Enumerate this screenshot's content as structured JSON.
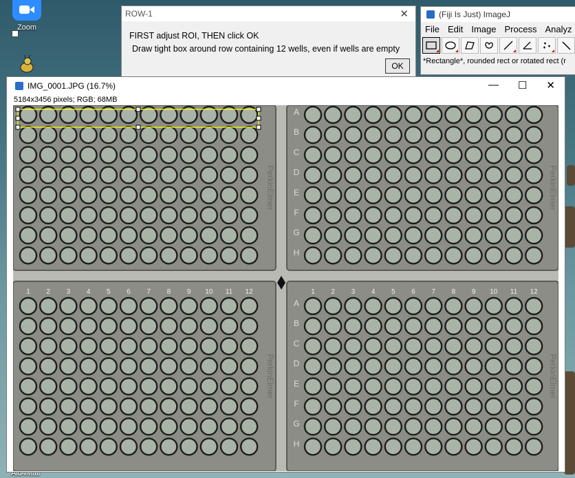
{
  "desktop": {
    "zoom_label": "Zoom",
    "aid4mail_label": "Aid4Mail"
  },
  "imagej": {
    "title": "(Fiji Is Just) ImageJ",
    "menus": [
      "File",
      "Edit",
      "Image",
      "Process",
      "Analyz"
    ],
    "tools": [
      "rectangle-icon",
      "oval-icon",
      "polygon-icon",
      "freehand-icon",
      "line-icon",
      "angle-icon",
      "multipoint-icon",
      "wand-icon"
    ],
    "status": "*Rectangle*, rounded rect or rotated rect (r"
  },
  "dialog": {
    "title": "ROW-1",
    "line1": "FIRST adjust ROI, THEN click OK",
    "line2": "Draw tight box around row containing 12 wells, even if wells are empty",
    "ok_label": "OK"
  },
  "image_window": {
    "title": "IMG_0001.JPG (16.7%)",
    "info": "5184x3456 pixels; RGB; 68MB",
    "minimize": "—",
    "maximize": "☐",
    "close": "✕"
  },
  "plates": {
    "brand": "PerkinElmer",
    "rows": [
      "A",
      "B",
      "C",
      "D",
      "E",
      "F",
      "G",
      "H"
    ],
    "columns": [
      "1",
      "2",
      "3",
      "4",
      "5",
      "6",
      "7",
      "8",
      "9",
      "10",
      "11",
      "12"
    ]
  },
  "colors": {
    "roi": "#ffff00",
    "well_fill": "#a9b3a8",
    "plate": "#8c8d86",
    "selection_handle": "#ffffff"
  }
}
